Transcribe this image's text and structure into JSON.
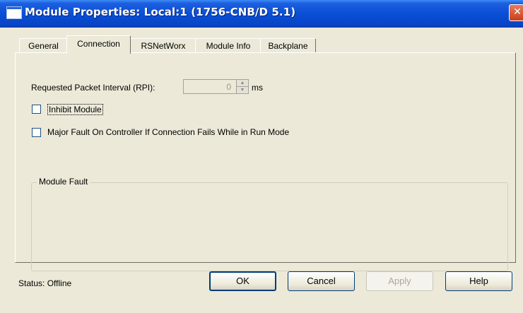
{
  "window": {
    "title": "Module Properties: Local:1 (1756-CNB/D 5.1)",
    "close_glyph": "✕"
  },
  "tabs": [
    {
      "label": "General"
    },
    {
      "label": "Connection",
      "active": true
    },
    {
      "label": "RSNetWorx"
    },
    {
      "label": "Module Info"
    },
    {
      "label": "Backplane"
    }
  ],
  "connection": {
    "rpi_label": "Requested Packet Interval (RPI):",
    "rpi_value": "0",
    "rpi_unit": "ms",
    "inhibit_label": "Inhibit Module",
    "inhibit_checked": false,
    "major_fault_label": "Major Fault On Controller If Connection Fails While in Run Mode",
    "major_fault_checked": false,
    "module_fault_title": "Module Fault"
  },
  "status": {
    "label": "Status:",
    "value": "Offline"
  },
  "buttons": {
    "ok": "OK",
    "cancel": "Cancel",
    "apply": "Apply",
    "help": "Help"
  },
  "colors": {
    "titlebar": "#0a4fd6",
    "dialog_bg": "#ece9d8",
    "close_button": "#c8401c"
  }
}
